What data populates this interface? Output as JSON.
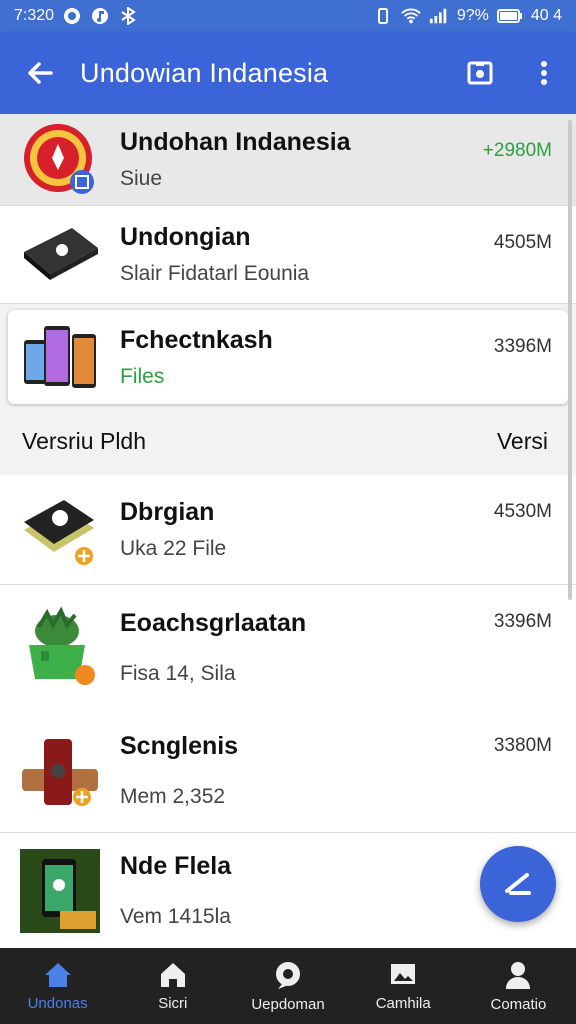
{
  "status_bar": {
    "time": "7:320",
    "battery": "9?%",
    "right_text": "40 4",
    "icons": [
      "record-icon",
      "music-icon",
      "bluetooth-icon",
      "vibrate-icon",
      "wifi-icon",
      "signal-icon",
      "battery-icon"
    ]
  },
  "app_bar": {
    "title": "Undowian Indanesia",
    "icons": [
      "back-arrow-icon",
      "camera-icon",
      "more-vert-icon"
    ]
  },
  "items_top": [
    {
      "title": "Undohan Indanesia",
      "sub": "Siue",
      "size": "+2980M",
      "size_color": "#2aa042",
      "sub_color": "#444",
      "icon": "emblem-icon",
      "highlight": true
    },
    {
      "title": "Undongian",
      "sub": "Slair Fidatarl Eounia",
      "size": "4505M",
      "size_color": "#333",
      "sub_color": "#444",
      "icon": "device-card-icon",
      "highlight": false
    },
    {
      "title": "Fchectnkash",
      "sub": "Files",
      "size": "3396M",
      "size_color": "#333",
      "sub_color": "#2aa042",
      "icon": "phones-icon",
      "highlight": false
    }
  ],
  "section": {
    "left": "Versriu Pldh",
    "right": "Versi"
  },
  "items_bottom": [
    {
      "title": "Dbrgian",
      "sub": "Uka 22 File",
      "size": "4530M",
      "icon": "book-stack-icon"
    },
    {
      "title": "Eoachsgrlaatan",
      "sub": "Fisa 14, Sila",
      "size": "3396M",
      "icon": "plant-pot-icon"
    },
    {
      "title": "Scnglenis",
      "sub": "Mem 2,352",
      "size": "3380M",
      "icon": "speaker-icon"
    },
    {
      "title": "Nde Flela",
      "sub": "Vem 1415la",
      "size": "",
      "icon": "phone-photo-icon"
    }
  ],
  "fab": {
    "icon": "edit-icon"
  },
  "bottom_nav": [
    {
      "label": "Undonas",
      "icon": "home-icon",
      "active": true
    },
    {
      "label": "Sicri",
      "icon": "home-alt-icon",
      "active": false
    },
    {
      "label": "Uepdoman",
      "icon": "chat-icon",
      "active": false
    },
    {
      "label": "Camhila",
      "icon": "image-icon",
      "active": false
    },
    {
      "label": "Comatio",
      "icon": "person-icon",
      "active": false
    }
  ],
  "colors": {
    "primary": "#3b64d8",
    "accent_green": "#2aa042",
    "nav_bg": "#222222",
    "nav_active": "#4a80e8"
  }
}
